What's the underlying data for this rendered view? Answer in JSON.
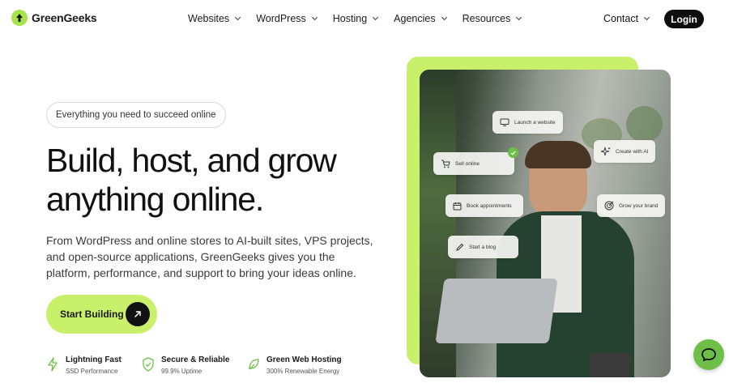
{
  "brand": {
    "name": "GreenGeeks",
    "accent": "#c9f06a",
    "logo_color": "#a9e34b"
  },
  "nav": {
    "items": [
      {
        "label": "Websites"
      },
      {
        "label": "WordPress"
      },
      {
        "label": "Hosting"
      },
      {
        "label": "Agencies"
      },
      {
        "label": "Resources"
      }
    ],
    "contact_label": "Contact",
    "login_label": "Login"
  },
  "hero": {
    "pill": "Everything you need to succeed online",
    "headline_line1": "Build, host, and grow",
    "headline_line2": "anything online.",
    "subtext": "From WordPress and online stores to AI-built sites, VPS projects, and open-source applications, GreenGeeks gives you the platform, performance, and support to bring your ideas online.",
    "cta_label": "Start Building"
  },
  "features": [
    {
      "title": "Lightning Fast",
      "sub": "SSD Performance",
      "icon": "bolt-icon"
    },
    {
      "title": "Secure & Reliable",
      "sub": "99.9% Uptime",
      "icon": "shield-check-icon"
    },
    {
      "title": "Green Web Hosting",
      "sub": "300% Renewable Energy",
      "icon": "leaf-icon"
    }
  ],
  "image_tags": [
    {
      "label": "Launch a website",
      "icon": "monitor-icon"
    },
    {
      "label": "Sell online",
      "icon": "cart-icon"
    },
    {
      "label": "Create with AI",
      "icon": "sparkle-icon"
    },
    {
      "label": "Book appointments",
      "icon": "calendar-icon"
    },
    {
      "label": "Grow your brand",
      "icon": "target-icon"
    },
    {
      "label": "Start a blog",
      "icon": "pencil-icon"
    }
  ]
}
